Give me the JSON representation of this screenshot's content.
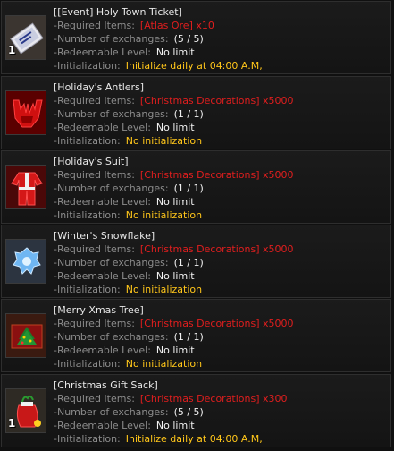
{
  "labels": {
    "required": "-Required Items:",
    "exchanges": "-Number of exchanges:",
    "level": "-Redeemable Level:",
    "init": "-Initialization:"
  },
  "items": [
    {
      "name": "[[Event] Holy Town Ticket]",
      "required": "[Atlas Ore] x10",
      "exchanges": "(5 / 5)",
      "level": "No limit",
      "init": "Initialize daily at 04:00 A.M,",
      "qty": "1",
      "icon": "ticket-icon"
    },
    {
      "name": "[Holiday's Antlers]",
      "required": "[Christmas Decorations] x5000",
      "exchanges": "(1 / 1)",
      "level": "No limit",
      "init": "No initialization",
      "qty": "",
      "icon": "antlers-icon"
    },
    {
      "name": "[Holiday's Suit]",
      "required": "[Christmas Decorations] x5000",
      "exchanges": "(1 / 1)",
      "level": "No limit",
      "init": "No initialization",
      "qty": "",
      "icon": "suit-icon"
    },
    {
      "name": "[Winter's Snowflake]",
      "required": "[Christmas Decorations] x5000",
      "exchanges": "(1 / 1)",
      "level": "No limit",
      "init": "No initialization",
      "qty": "",
      "icon": "snowflake-icon"
    },
    {
      "name": "[Merry Xmas Tree]",
      "required": "[Christmas Decorations] x5000",
      "exchanges": "(1 / 1)",
      "level": "No limit",
      "init": "No initialization",
      "qty": "",
      "icon": "xmas-tree-icon"
    },
    {
      "name": "[Christmas Gift Sack]",
      "required": "[Christmas Decorations] x300",
      "exchanges": "(5 / 5)",
      "level": "No limit",
      "init": "Initialize daily at 04:00 A.M,",
      "qty": "1",
      "icon": "gift-sack-icon"
    }
  ],
  "colors": {
    "title": "#e8e8e8",
    "label": "#8c8c8c",
    "required": "#e01e1e",
    "value": "#f2f2f2",
    "init": "#ffc61a"
  }
}
